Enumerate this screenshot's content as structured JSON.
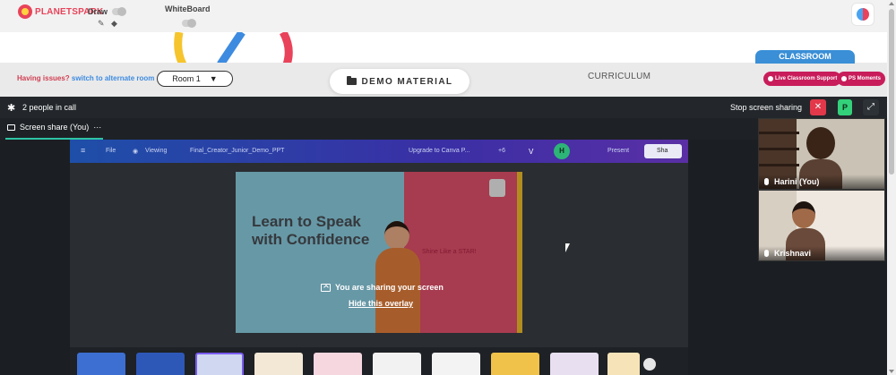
{
  "header": {
    "logo_text": "PLANETSPARK",
    "draw_label": "Draw",
    "whiteboard_label": "WhiteBoard"
  },
  "nav": {
    "issues_text": "Having issues?",
    "alternate_room_text": "switch to alternate room",
    "room_value": "Room 1",
    "demo_material_label": "DEMO MATERIAL",
    "curriculum_label": "CURRICULUM",
    "classroom_label": "CLASSROOM",
    "live_support_label": "Live Classroom Support",
    "ps_moments_label": "PS Moments"
  },
  "call": {
    "people_in_call": "2 people in call",
    "stop_sharing_label": "Stop screen sharing",
    "participant_initial": "P",
    "screen_share_tab": "Screen share (You)",
    "overlay_message": "You are sharing your screen",
    "hide_overlay_label": "Hide this overlay"
  },
  "shared_screen": {
    "menu_file": "File",
    "menu_viewing": "Viewing",
    "doc_title": "Final_Creator_Junior_Demo_PPT",
    "upgrade_label": "Upgrade to Canva P...",
    "collab_count": "+6",
    "avatar_v": "V",
    "avatar_h": "H",
    "present_label": "Present",
    "share_label": "Sha",
    "slide_headline": "Learn to Speak with Confidence",
    "slide_tagline": "Shine Like a STAR!"
  },
  "participants": [
    {
      "name": "Harini (You)"
    },
    {
      "name": "Krishnavi"
    }
  ],
  "colors": {
    "brand_red": "#e8435a",
    "classroom_blue": "#3a8fd6",
    "pill_pink": "#c81d5a",
    "stop_red": "#e3384a",
    "accent_green": "#2ec4a5"
  }
}
